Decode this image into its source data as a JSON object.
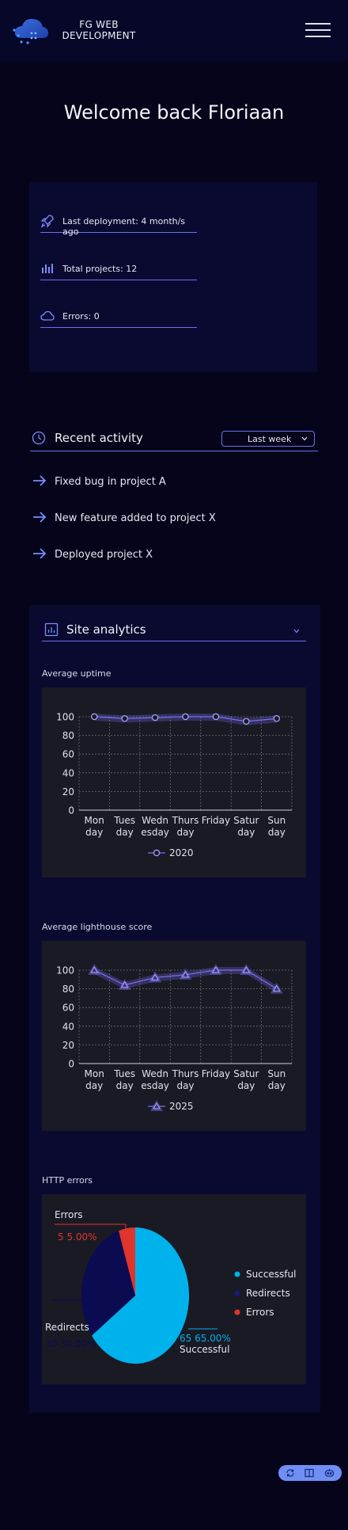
{
  "header": {
    "brand_line1": "FG WEB",
    "brand_line2": "DEVELOPMENT",
    "logo_icon": "cloud-logo-icon",
    "menu_icon": "hamburger-menu-icon"
  },
  "welcome": "Welcome back Floriaan",
  "summary": {
    "items": [
      {
        "icon": "rocket-icon",
        "label": "Last deployment: 4 month/s ago"
      },
      {
        "icon": "bar-chart-icon",
        "label": "Total projects: 12"
      },
      {
        "icon": "cloud-icon",
        "label": "Errors: 0"
      }
    ]
  },
  "recent": {
    "title": "Recent activity",
    "filter": "Last week",
    "items": [
      "Fixed bug in project A",
      "New feature added to project X",
      "Deployed project X"
    ]
  },
  "analytics": {
    "title": "Site analytics",
    "uptime_label": "Average uptime",
    "lighthouse_label": "Average lighthouse score",
    "http_label": "HTTP errors"
  },
  "chart_data": [
    {
      "type": "line",
      "title": "",
      "categories": [
        "Mon day",
        "Tues day",
        "Wedn esday",
        "Thurs day",
        "Friday",
        "Satur day",
        "Sun day"
      ],
      "series": [
        {
          "name": "2020",
          "values": [
            100,
            98,
            99,
            100,
            100,
            95,
            98
          ],
          "color": "#7b6ef6"
        }
      ],
      "ylim": [
        0,
        100
      ],
      "yticks": [
        0,
        20,
        40,
        60,
        80,
        100
      ],
      "grid": true,
      "legend": "bottom"
    },
    {
      "type": "line",
      "title": "",
      "categories": [
        "Mon day",
        "Tues day",
        "Wedn esday",
        "Thurs day",
        "Friday",
        "Satur day",
        "Sun day"
      ],
      "series": [
        {
          "name": "2025",
          "values": [
            100,
            84,
            92,
            95,
            100,
            100,
            80
          ],
          "color": "#7b6ef6"
        }
      ],
      "ylim": [
        0,
        100
      ],
      "yticks": [
        0,
        20,
        40,
        60,
        80,
        100
      ],
      "grid": true,
      "legend": "bottom"
    },
    {
      "type": "pie",
      "title": "",
      "slices": [
        {
          "name": "Successful",
          "value": 65,
          "percent": "65.00%",
          "color": "#00b2ec"
        },
        {
          "name": "Redirects",
          "value": 30,
          "percent": "30.00%",
          "color": "#0b0b52"
        },
        {
          "name": "Errors",
          "value": 5,
          "percent": "5.00%",
          "color": "#e0342d"
        }
      ],
      "legend": "right"
    }
  ]
}
